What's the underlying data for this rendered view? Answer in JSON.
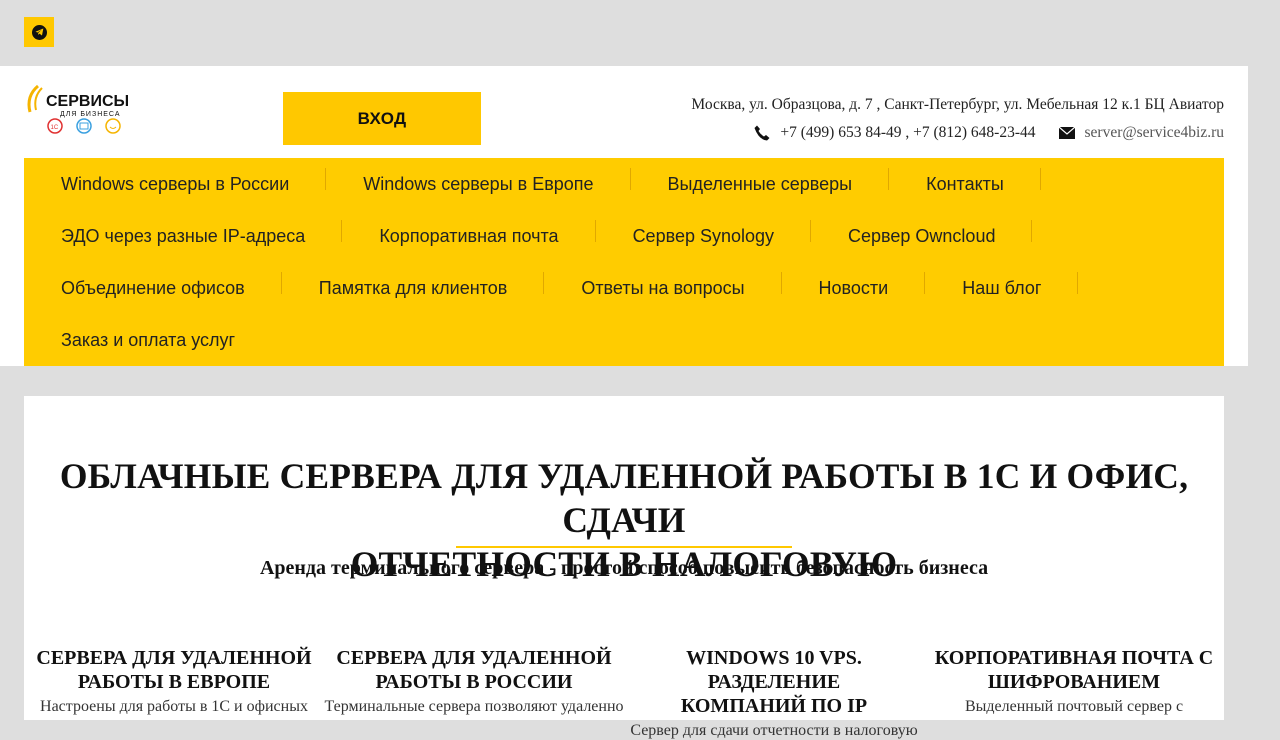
{
  "telegram": {
    "icon": "telegram-icon"
  },
  "logo": {
    "main": "СЕРВИСЫ",
    "sub": "ДЛЯ БИЗНЕСА",
    "badges": [
      "1С",
      "mail",
      "smile"
    ]
  },
  "header": {
    "login_label": "ВХОД",
    "address": "Москва, ул. Образцова, д. 7 , Санкт-Петербург, ул. Мебельная 12 к.1 БЦ Авиатор",
    "phones": "+7 (499) 653 84-49 , +7 (812) 648-23-44",
    "email": "server@service4biz.ru"
  },
  "nav": {
    "rows": [
      [
        "Windows серверы в России",
        "Windows серверы в Европе",
        "Выделенные серверы",
        "Контакты"
      ],
      [
        "ЭДО через разные IP-адреса",
        "Корпоративная почта",
        "Сервер Synology",
        "Сервер Owncloud"
      ],
      [
        "Объединение офисов",
        "Памятка для клиентов",
        "Ответы на вопросы",
        "Новости",
        "Наш блог"
      ],
      [
        "Заказ и оплата услуг"
      ]
    ]
  },
  "hero": {
    "title_line1": "ОБЛАЧНЫЕ СЕРВЕРА ДЛЯ УДАЛЕННОЙ РАБОТЫ В 1С И ОФИС, СДАЧИ",
    "title_line2": "ОТЧЕТНОСТИ В НАЛОГОВУЮ",
    "subtitle": "Аренда терминального сервера - простой способ повысить безопасность бизнеса"
  },
  "cards": [
    {
      "title_line1": "СЕРВЕРА ДЛЯ УДАЛЕННОЙ",
      "title_line2": "РАБОТЫ В ЕВРОПЕ",
      "text": "Настроены для работы в 1С и офисных"
    },
    {
      "title_line1": "СЕРВЕРА ДЛЯ УДАЛЕННОЙ",
      "title_line2": "РАБОТЫ В РОССИИ",
      "text": "Терминальные сервера позволяют удаленно"
    },
    {
      "title_line1": "WINDOWS 10 VPS. РАЗДЕЛЕНИЕ",
      "title_line2": "КОМПАНИЙ ПО IP",
      "text": "Сервер для сдачи отчетности в налоговую"
    },
    {
      "title_line1": "КОРПОРАТИВНАЯ ПОЧТА С",
      "title_line2": "ШИФРОВАНИЕМ",
      "text": "Выделенный почтовый сервер с"
    }
  ],
  "colors": {
    "accent": "#ffcc00",
    "background": "#dedede"
  }
}
